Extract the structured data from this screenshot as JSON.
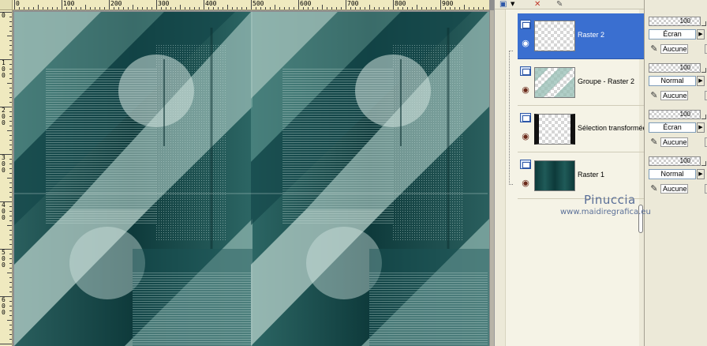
{
  "ruler": {
    "top_labels": [
      "0",
      "100",
      "200",
      "300",
      "400",
      "500",
      "600",
      "700",
      "800",
      "900"
    ],
    "left_labels": [
      "0",
      "100",
      "200",
      "300",
      "400",
      "500",
      "600"
    ]
  },
  "layers_toolbar": {
    "icons": [
      "new-layer-icon",
      "delete-layer-icon",
      "brush-icon"
    ]
  },
  "layers": [
    {
      "name": "Raster 2",
      "selected": true,
      "thumb": "checker"
    },
    {
      "name": "Groupe - Raster 2",
      "selected": false,
      "thumb": "glass"
    },
    {
      "name": "Sélection transformée",
      "selected": false,
      "thumb": "frame"
    },
    {
      "name": "Raster 1",
      "selected": false,
      "thumb": "dark-teal"
    }
  ],
  "blend_rows": [
    {
      "opacity": "100",
      "mode": "Écran",
      "mask": "Aucune"
    },
    {
      "opacity": "100",
      "mode": "Normal",
      "mask": "Aucune"
    },
    {
      "opacity": "100",
      "mode": "Écran",
      "mask": "Aucune"
    },
    {
      "opacity": "100",
      "mode": "Normal",
      "mask": "Aucune"
    }
  ],
  "watermark": {
    "name": "Pinuccia",
    "url": "www.maidiregrafica.eu"
  },
  "colors": {
    "teal_dark": "#0f3b3c",
    "teal_mid": "#3d7472",
    "teal_light": "#a7c6bf",
    "selection_blue": "#3a6fd0"
  }
}
